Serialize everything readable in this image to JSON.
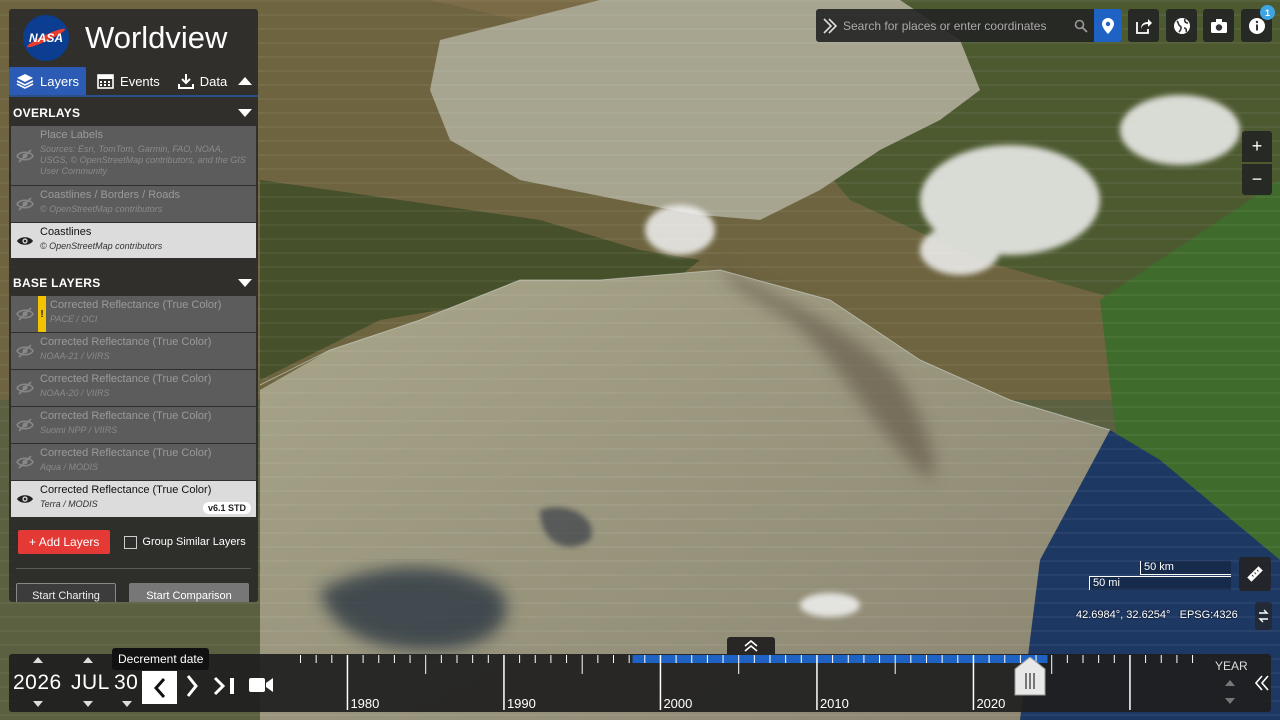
{
  "app": {
    "title": "Worldview",
    "logo_text": "NASA"
  },
  "tabs": [
    {
      "label": "Layers",
      "icon": "layers-icon",
      "active": true
    },
    {
      "label": "Events",
      "icon": "calendar-icon",
      "active": false
    },
    {
      "label": "Data",
      "icon": "download-icon",
      "active": false
    }
  ],
  "overlays": {
    "header": "OVERLAYS",
    "items": [
      {
        "name": "Place Labels",
        "sub": "Sources: Esri, TomTom, Garmin, FAO, NOAA, USGS, © OpenStreetMap contributors, and the GIS User Community",
        "visible": false
      },
      {
        "name": "Coastlines / Borders / Roads",
        "sub": "© OpenStreetMap contributors",
        "visible": false
      },
      {
        "name": "Coastlines",
        "sub": "© OpenStreetMap contributors",
        "visible": true
      }
    ]
  },
  "base_layers": {
    "header": "BASE LAYERS",
    "items": [
      {
        "name": "Corrected Reflectance (True Color)",
        "sub": "PACE / OCI",
        "visible": false,
        "warning": "!"
      },
      {
        "name": "Corrected Reflectance (True Color)",
        "sub": "NOAA-21 / VIIRS",
        "visible": false
      },
      {
        "name": "Corrected Reflectance (True Color)",
        "sub": "NOAA-20 / VIIRS",
        "visible": false
      },
      {
        "name": "Corrected Reflectance (True Color)",
        "sub": "Suomi NPP / VIIRS",
        "visible": false
      },
      {
        "name": "Corrected Reflectance (True Color)",
        "sub": "Aqua / MODIS",
        "visible": false
      },
      {
        "name": "Corrected Reflectance (True Color)",
        "sub": "Terra / MODIS",
        "visible": true,
        "badge": "v6.1 STD"
      }
    ]
  },
  "actions": {
    "add_layers": "Add Layers",
    "group_similar": "Group Similar Layers",
    "start_charting": "Start Charting",
    "start_comparison": "Start Comparison"
  },
  "search": {
    "placeholder": "Search for places or enter coordinates"
  },
  "toolbar": {
    "info_badge": "1"
  },
  "zoom": {
    "in": "+",
    "out": "−"
  },
  "scale": {
    "km": "50 km",
    "mi": "50 mi"
  },
  "coordinates": {
    "text": "42.6984°, 32.6254°",
    "projection": "EPSG:4326"
  },
  "timeline": {
    "year": "2026",
    "month": "JUL",
    "day": "30",
    "tooltip": "Decrement date",
    "axis_labels": [
      "1980",
      "1990",
      "2000",
      "2010",
      "2020"
    ],
    "interval": "YEAR"
  },
  "colors": {
    "accent": "#2c5bb6",
    "add_button": "#e53935",
    "coverage": "#1e63c4"
  }
}
